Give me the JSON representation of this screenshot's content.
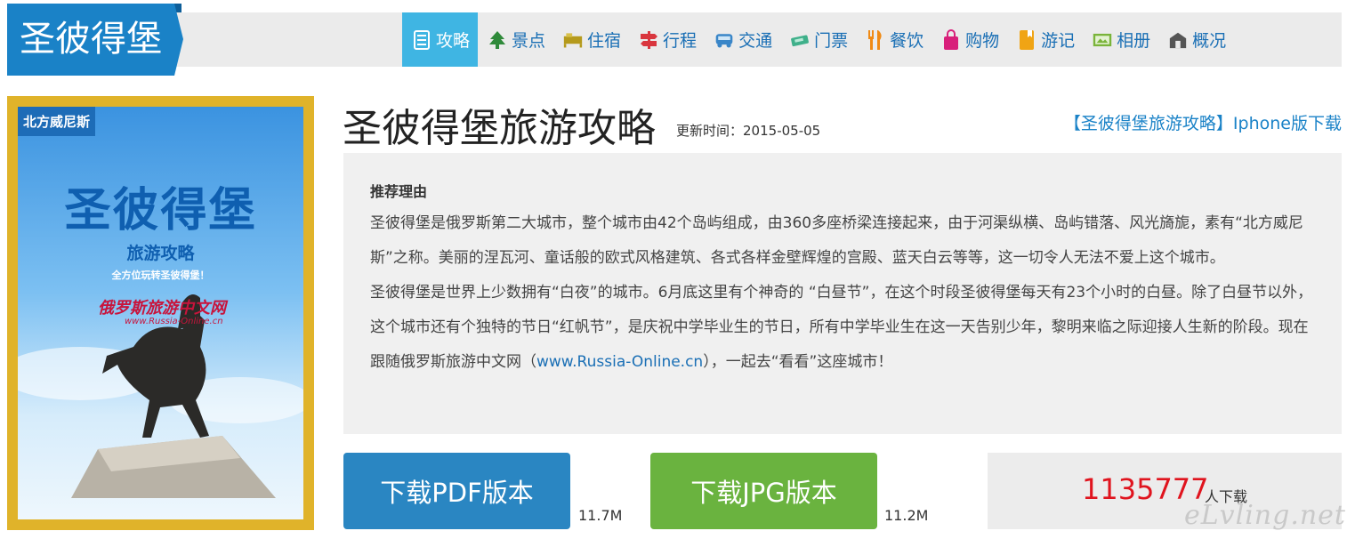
{
  "brand": {
    "title": "圣彼得堡"
  },
  "nav": {
    "tabs": [
      {
        "label": "攻略",
        "icon": "document-icon",
        "color": "#ffffff"
      },
      {
        "label": "景点",
        "icon": "tree-icon",
        "color": "#2f8a3a"
      },
      {
        "label": "住宿",
        "icon": "bed-icon",
        "color": "#b59a1c"
      },
      {
        "label": "行程",
        "icon": "signpost-icon",
        "color": "#d9363e"
      },
      {
        "label": "交通",
        "icon": "bus-icon",
        "color": "#3a86c8"
      },
      {
        "label": "门票",
        "icon": "ticket-icon",
        "color": "#3fb08a"
      },
      {
        "label": "餐饮",
        "icon": "fork-icon",
        "color": "#f08a14"
      },
      {
        "label": "购物",
        "icon": "bag-icon",
        "color": "#d81f7a"
      },
      {
        "label": "游记",
        "icon": "notebook-icon",
        "color": "#f0a414"
      },
      {
        "label": "相册",
        "icon": "photo-icon",
        "color": "#7ab43a"
      },
      {
        "label": "概况",
        "icon": "house-icon",
        "color": "#555555"
      }
    ],
    "active_index": 0,
    "active_color": "#3fb5e3"
  },
  "cover": {
    "tag": "北方威尼斯",
    "title": "圣彼得堡",
    "subtitle": "旅游攻略",
    "tagline": "全方位玩转圣彼得堡！",
    "logo": "俄罗斯旅游中文网",
    "url": "www.Russia-Online.cn"
  },
  "header": {
    "title": "圣彼得堡旅游攻略",
    "update_label": "更新时间：",
    "update_date": "2015-05-05",
    "iphone_link": "【圣彼得堡旅游攻略】Iphone版下载"
  },
  "reason": {
    "heading": "推荐理由",
    "para1": " 圣彼得堡是俄罗斯第二大城市，整个城市由42个岛屿组成，由360多座桥梁连接起来，由于河渠纵横、岛屿错落、风光旖旎，素有“北方威尼斯”之称。美丽的涅瓦河、童话般的欧式风格建筑、各式各样金壁辉煌的宫殿、蓝天白云等等，这一切令人无法不爱上这个城市。",
    "para2_a": "圣彼得堡是世界上少数拥有“白夜”的城市。6月底这里有个神奇的 “白昼节”，在这个时段圣彼得堡每天有23个小时的白昼。除了白昼节以外，这个城市还有个独特的节日“红帆节”，是庆祝中学毕业生的节日，所有中学毕业生在这一天告别少年，黎明来临之际迎接人生新的阶段。现在跟随俄罗斯旅游中文网（",
    "para2_link": "www.Russia-Online.cn",
    "para2_b": "），一起去“看看”这座城市！"
  },
  "downloads": {
    "pdf_label": "下载PDF版本",
    "pdf_size": "11.7M",
    "jpg_label": "下载JPG版本",
    "jpg_size": "11.2M",
    "count": "1135777",
    "count_unit": "人下载"
  },
  "watermark": "eLvling.net"
}
